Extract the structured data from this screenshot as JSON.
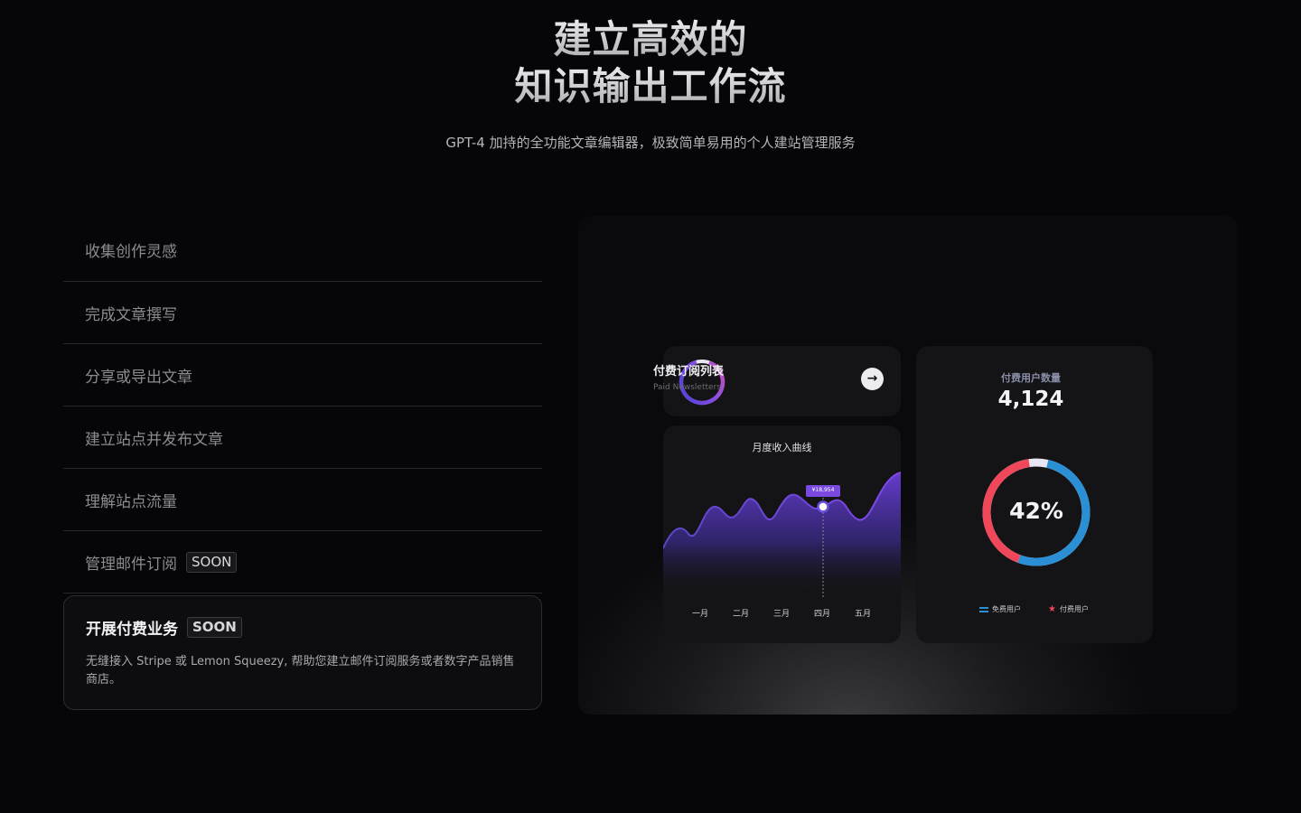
{
  "hero": {
    "title_line1": "建立高效的",
    "title_line2": "知识输出工作流",
    "subtitle": "GPT-4 加持的全功能文章编辑器，极致简单易用的个人建站管理服务"
  },
  "features": {
    "items": [
      {
        "label": "收集创作灵感"
      },
      {
        "label": "完成文章撰写"
      },
      {
        "label": "分享或导出文章"
      },
      {
        "label": "建立站点并发布文章"
      },
      {
        "label": "理解站点流量"
      },
      {
        "label": "管理邮件订阅",
        "badge": "SOON"
      }
    ],
    "active": {
      "label": "开展付费业务",
      "badge": "SOON",
      "description": "无缝接入 Stripe 或 Lemon Squeezy, 帮助您建立邮件订阅服务或者数字产品销售商店。"
    }
  },
  "dashboard": {
    "newsletters": {
      "title": "付费订阅列表",
      "subtitle": "Paid Newsletters",
      "arrow_icon": "arrow-right-icon"
    },
    "revenue": {
      "title": "月度收入曲线",
      "tooltip": "¥18,954",
      "months": [
        "一月",
        "二月",
        "三月",
        "四月",
        "五月"
      ]
    },
    "users": {
      "label": "付费用户数量",
      "count": "4,124",
      "percent_label": "42%",
      "paid_fraction": 0.42,
      "legend_free": "免费用户",
      "legend_paid": "付费用户"
    },
    "colors": {
      "purple": "#7c4ddc",
      "blue": "#2b8fd6",
      "red": "#f0475a",
      "track": "#e8e6f0"
    }
  },
  "chart_data": {
    "type": "area",
    "title": "月度收入曲线",
    "categories": [
      "一月",
      "二月",
      "三月",
      "四月",
      "五月"
    ],
    "annotations": [
      {
        "category": "四月",
        "label": "¥18,954"
      }
    ]
  }
}
